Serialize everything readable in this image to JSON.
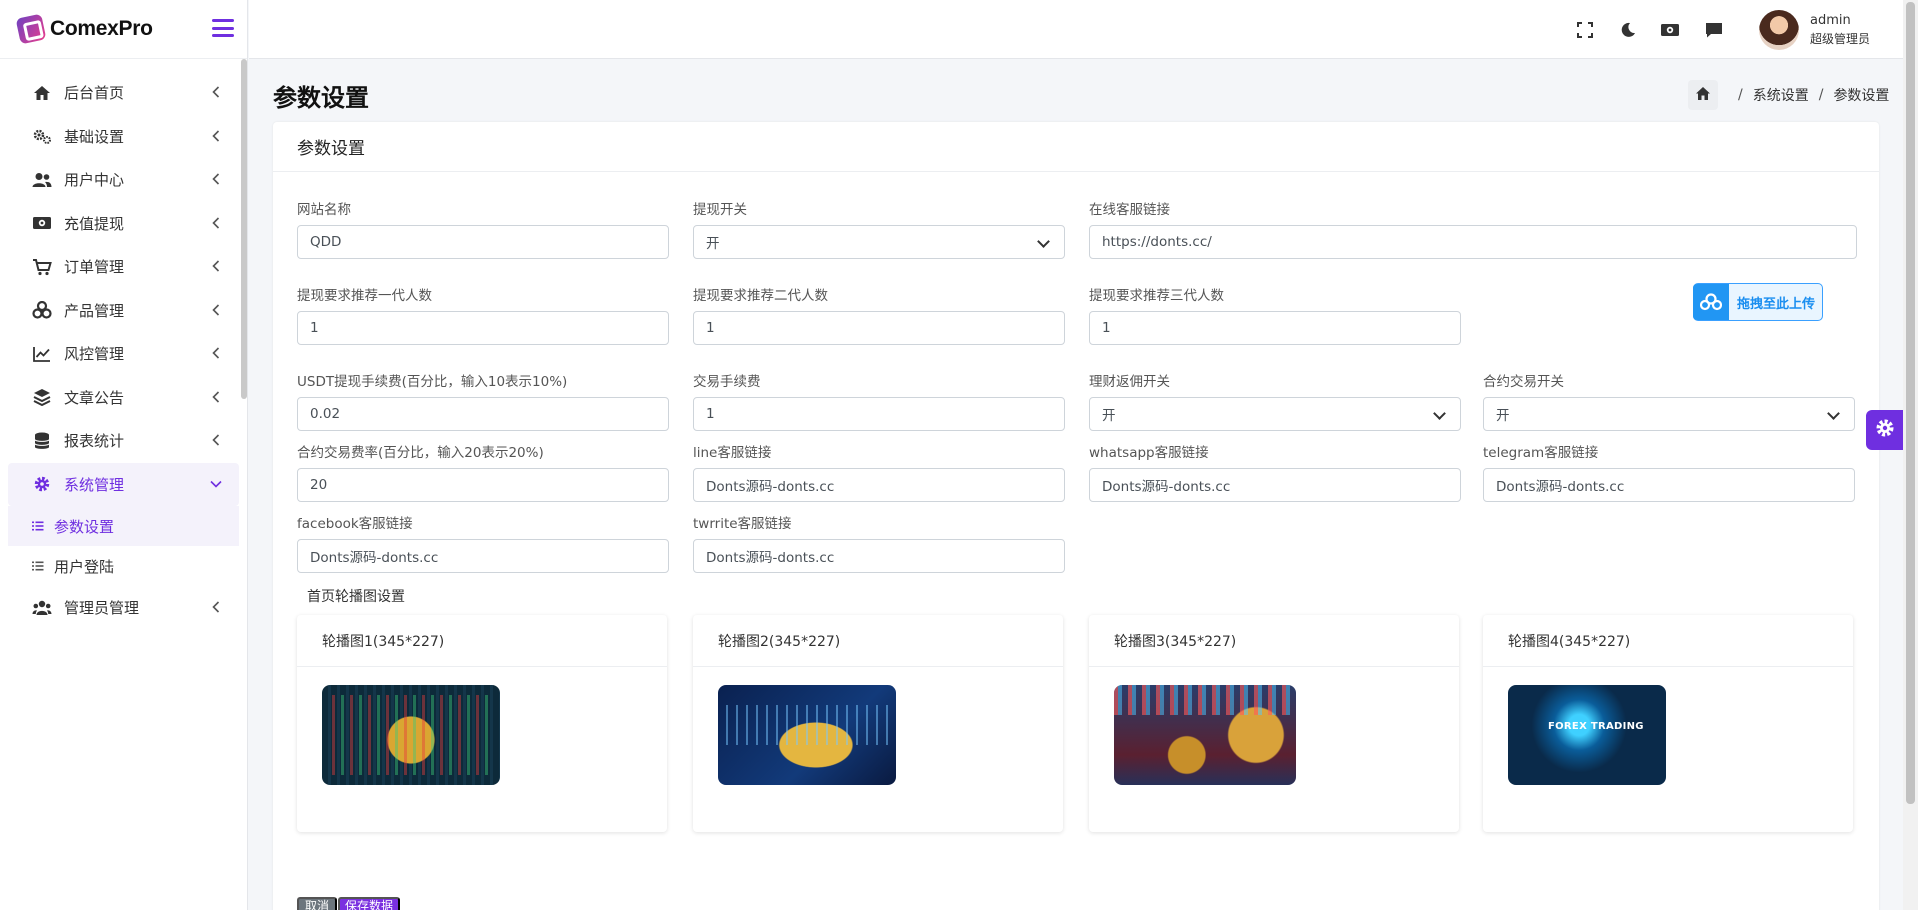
{
  "brand": {
    "name": "ComexPro"
  },
  "sidebar": {
    "items": [
      {
        "label": "后台首页",
        "icon": "home-icon"
      },
      {
        "label": "基础设置",
        "icon": "cogs-icon"
      },
      {
        "label": "用户中心",
        "icon": "users-icon"
      },
      {
        "label": "充值提现",
        "icon": "money-icon"
      },
      {
        "label": "订单管理",
        "icon": "cart-icon"
      },
      {
        "label": "产品管理",
        "icon": "cubes-icon"
      },
      {
        "label": "风控管理",
        "icon": "chart-line-icon"
      },
      {
        "label": "文章公告",
        "icon": "layers-icon"
      },
      {
        "label": "报表统计",
        "icon": "database-icon"
      },
      {
        "label": "系统管理",
        "icon": "gear-icon"
      },
      {
        "label": "管理员管理",
        "icon": "user-group-icon"
      }
    ],
    "subitems": [
      {
        "label": "参数设置"
      },
      {
        "label": "用户登陆"
      }
    ]
  },
  "topbar": {
    "user_name": "admin",
    "user_role": "超级管理员"
  },
  "page": {
    "title": "参数设置",
    "breadcrumb": [
      "系统设置",
      "参数设置"
    ],
    "card_title": "参数设置"
  },
  "form": {
    "site_name_label": "网站名称",
    "site_name_value": "QDD",
    "withdraw_switch_label": "提现开关",
    "withdraw_switch_value": "开",
    "online_service_label": "在线客服链接",
    "online_service_value": "https://donts.cc/",
    "ref1_label": "提现要求推荐一代人数",
    "ref1_value": "1",
    "ref2_label": "提现要求推荐二代人数",
    "ref2_value": "1",
    "ref3_label": "提现要求推荐三代人数",
    "ref3_value": "1",
    "upload_label": "拖拽至此上传",
    "usdt_fee_label": "USDT提现手续费(百分比，输入10表示10%)",
    "usdt_fee_value": "0.02",
    "trade_fee_label": "交易手续费",
    "trade_fee_value": "1",
    "finance_rebate_label": "理财返佣开关",
    "finance_rebate_value": "开",
    "contract_switch_label": "合约交易开关",
    "contract_switch_value": "开",
    "contract_rate_label": "合约交易费率(百分比，输入20表示20%)",
    "contract_rate_value": "20",
    "line_label": "line客服链接",
    "line_value": "Donts源码-donts.cc",
    "whatsapp_label": "whatsapp客服链接",
    "whatsapp_value": "Donts源码-donts.cc",
    "telegram_label": "telegram客服链接",
    "telegram_value": "Donts源码-donts.cc",
    "facebook_label": "facebook客服链接",
    "facebook_value": "Donts源码-donts.cc",
    "twitter_label": "twrrite客服链接",
    "twitter_value": "Donts源码-donts.cc"
  },
  "banners": {
    "section_title": "首页轮播图设置",
    "items": [
      {
        "title": "轮播图1(345*227)"
      },
      {
        "title": "轮播图2(345*227)"
      },
      {
        "title": "轮播图3(345*227)"
      },
      {
        "title": "轮播图4(345*227)",
        "image_text": "FOREX TRADING"
      }
    ]
  },
  "actions": {
    "cancel_label": "取消",
    "save_label": "保存数据"
  },
  "colors": {
    "accent": "#6f2fe0",
    "upload": "#2196f3"
  }
}
